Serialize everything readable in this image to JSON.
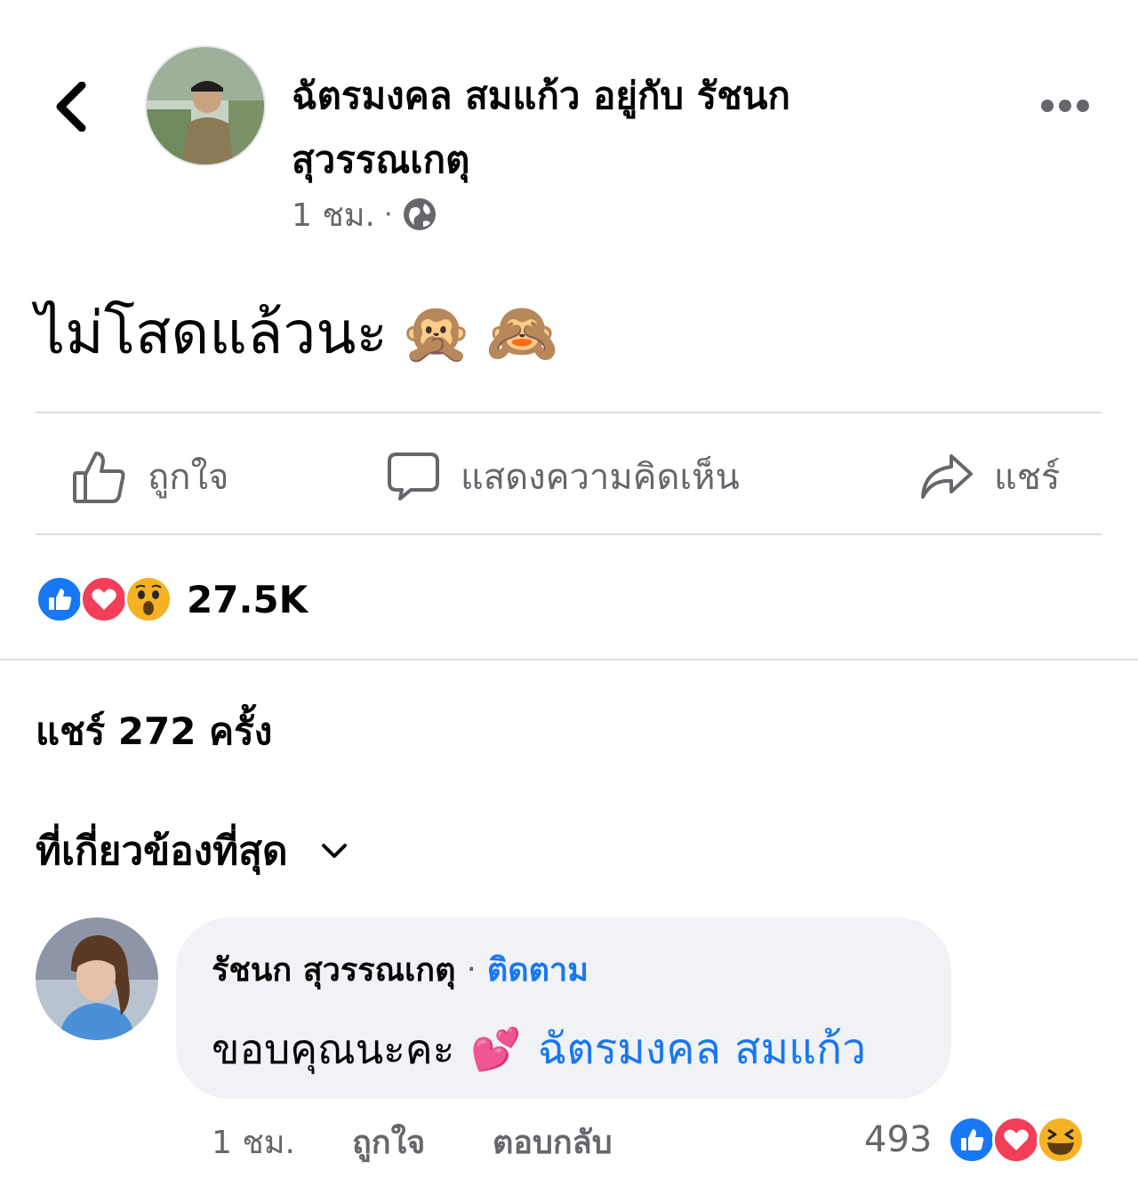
{
  "header": {
    "author_line1": "ฉัตรมงคล สมแก้ว อยู่กับ รัชนก",
    "author_line2": "สุวรรณเกตุ",
    "time": "1 ชม.",
    "dot": "·",
    "back_icon": "chevron-left-icon",
    "privacy_icon": "globe-icon",
    "more_icon": "more-horizontal-icon"
  },
  "post": {
    "text": "ไม่โสดแล้วนะ",
    "emojis": [
      "🙊",
      "🙈"
    ]
  },
  "actions": {
    "like_label": "ถูกใจ",
    "comment_label": "แสดงความคิดเห็น",
    "share_label": "แชร์"
  },
  "reactions": {
    "count": "27.5K",
    "types": [
      "like",
      "love",
      "wow"
    ]
  },
  "shares": {
    "text": "แชร์ 272 ครั้ง"
  },
  "sort": {
    "label": "ที่เกี่ยวข้องที่สุด"
  },
  "comment": {
    "name": "รัชนก สุวรรณเกตุ",
    "dot": "·",
    "follow_label": "ติดตาม",
    "text": "ขอบคุณนะคะ",
    "emoji": "💕",
    "mention": "ฉัตรมงคล สมแก้ว",
    "time": "1 ชม.",
    "like_label": "ถูกใจ",
    "reply_label": "ตอบกลับ",
    "reaction_count": "493",
    "reaction_types": [
      "like",
      "love",
      "haha"
    ]
  },
  "colors": {
    "accent": "#1877f2",
    "secondary_text": "#65676b",
    "love": "#f33e58",
    "bubble": "#f0f2f5"
  }
}
